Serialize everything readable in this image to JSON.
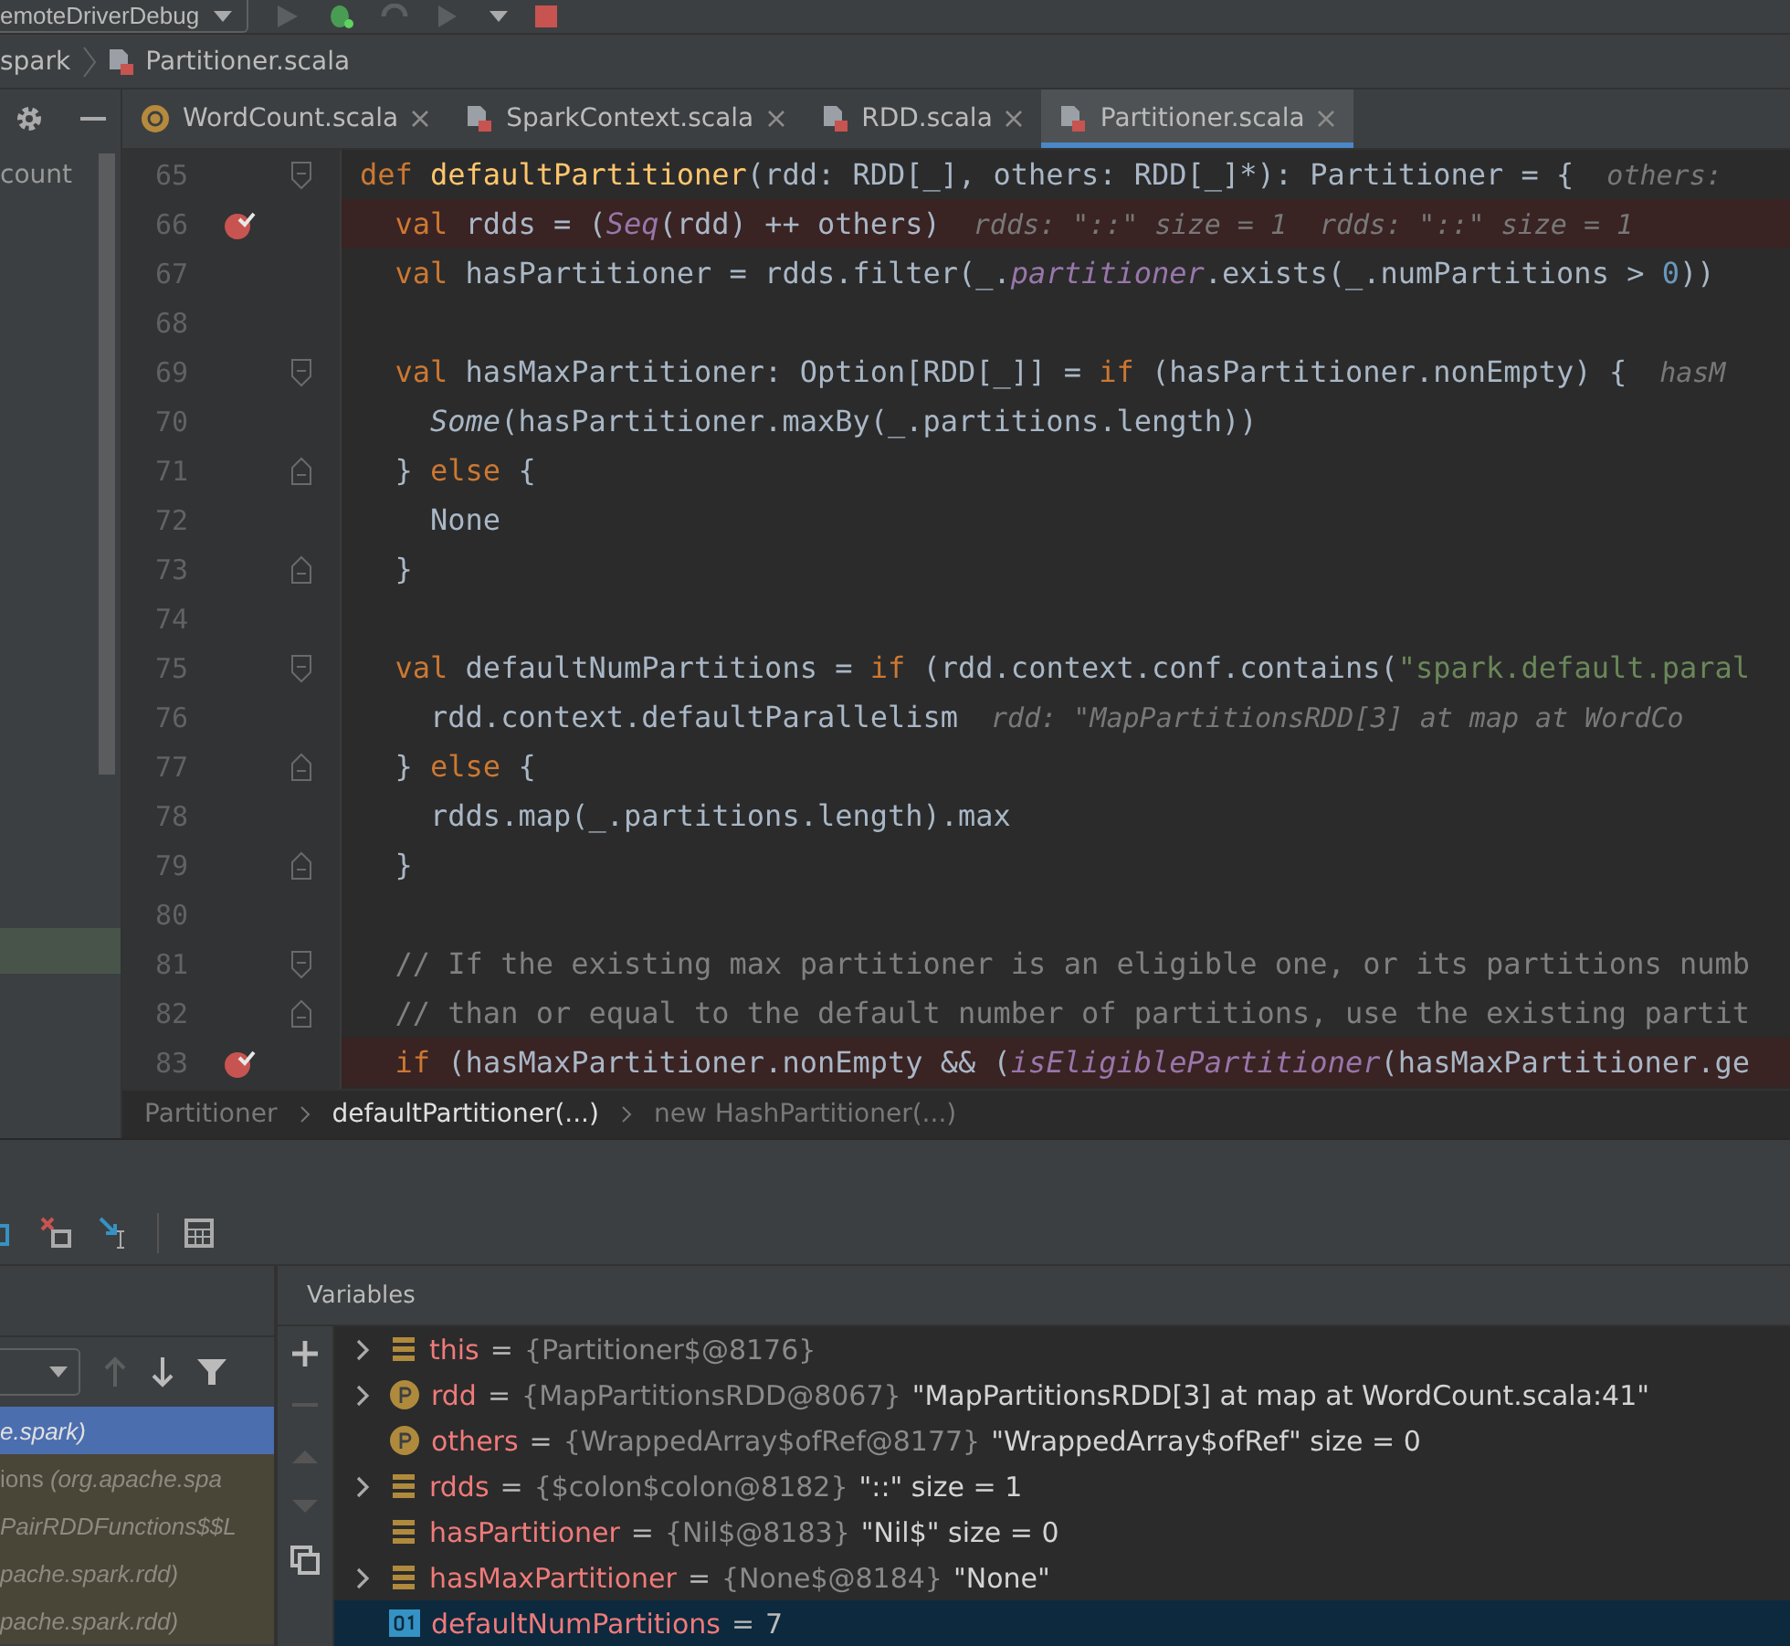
{
  "toolbar": {
    "run_config": "emoteDriverDebug"
  },
  "navigation": {
    "crumbs": [
      {
        "label": "spark",
        "kind": "folder"
      },
      {
        "label": "Partitioner.scala",
        "kind": "file"
      }
    ]
  },
  "project_panel": {
    "label": "count",
    "highlighted_row": true
  },
  "tabs": [
    {
      "label": "WordCount.scala",
      "kind": "source",
      "selected": false
    },
    {
      "label": "SparkContext.scala",
      "kind": "library",
      "selected": false
    },
    {
      "label": "RDD.scala",
      "kind": "library",
      "selected": false
    },
    {
      "label": "Partitioner.scala",
      "kind": "library",
      "selected": true
    }
  ],
  "code_lines": [
    {
      "number": "65",
      "kind": "fold_start",
      "breakpoint": false,
      "tokens": [
        {
          "kind": "keyword",
          "text": "def "
        },
        {
          "kind": "function",
          "text": "defaultPartitioner"
        },
        {
          "kind": "plain",
          "text": "(rdd: RDD[_], others: RDD[_]*): Partitioner = {"
        },
        {
          "kind": "hint",
          "text": "others:"
        }
      ]
    },
    {
      "number": "66",
      "kind": "plain",
      "breakpoint": true,
      "tokens": [
        {
          "kind": "keyword",
          "text": "  val "
        },
        {
          "kind": "plain",
          "text": "rdds = ("
        },
        {
          "kind": "member",
          "text": "Seq"
        },
        {
          "kind": "plain",
          "text": "(rdd) ++ others)"
        },
        {
          "kind": "hint",
          "text": "rdds: \"::\" size = 1"
        },
        {
          "kind": "hint",
          "text": "rdds: \"::\" size = 1"
        }
      ]
    },
    {
      "number": "67",
      "kind": "plain",
      "breakpoint": false,
      "tokens": [
        {
          "kind": "keyword",
          "text": "  val "
        },
        {
          "kind": "plain",
          "text": "hasPartitioner = rdds.filter(_."
        },
        {
          "kind": "member",
          "text": "partitioner"
        },
        {
          "kind": "plain",
          "text": ".exists(_.numPartitions > "
        },
        {
          "kind": "number",
          "text": "0"
        },
        {
          "kind": "plain",
          "text": "))"
        }
      ]
    },
    {
      "number": "68",
      "kind": "plain",
      "breakpoint": false
    },
    {
      "number": "69",
      "kind": "fold_start",
      "breakpoint": false,
      "tokens": [
        {
          "kind": "keyword",
          "text": "  val "
        },
        {
          "kind": "plain",
          "text": "hasMaxPartitioner: Option[RDD[_]] = "
        },
        {
          "kind": "keyword",
          "text": "if "
        },
        {
          "kind": "plain",
          "text": "(hasPartitioner.nonEmpty) {"
        },
        {
          "kind": "hint",
          "text": "hasM"
        }
      ]
    },
    {
      "number": "70",
      "kind": "plain",
      "breakpoint": false,
      "tokens": [
        {
          "kind": "italic",
          "text": "    Some"
        },
        {
          "kind": "plain",
          "text": "(hasPartitioner.maxBy(_.partitions.length))"
        }
      ]
    },
    {
      "number": "71",
      "kind": "fold_end",
      "breakpoint": false,
      "tokens": [
        {
          "kind": "plain",
          "text": "  } "
        },
        {
          "kind": "keyword",
          "text": "else "
        },
        {
          "kind": "plain",
          "text": "{"
        }
      ]
    },
    {
      "number": "72",
      "kind": "plain",
      "breakpoint": false,
      "tokens": [
        {
          "kind": "plain",
          "text": "    None"
        }
      ]
    },
    {
      "number": "73",
      "kind": "fold_end",
      "breakpoint": false,
      "tokens": [
        {
          "kind": "plain",
          "text": "  }"
        }
      ]
    },
    {
      "number": "74",
      "kind": "plain",
      "breakpoint": false
    },
    {
      "number": "75",
      "kind": "fold_start",
      "breakpoint": false,
      "tokens": [
        {
          "kind": "keyword",
          "text": "  val "
        },
        {
          "kind": "plain",
          "text": "defaultNumPartitions = "
        },
        {
          "kind": "keyword",
          "text": "if "
        },
        {
          "kind": "plain",
          "text": "(rdd.context.conf.contains("
        },
        {
          "kind": "string",
          "text": "\"spark.default.paral"
        }
      ]
    },
    {
      "number": "76",
      "kind": "plain",
      "breakpoint": false,
      "tokens": [
        {
          "kind": "plain",
          "text": "    rdd.context.defaultParallelism"
        },
        {
          "kind": "hint",
          "text": "rdd: \"MapPartitionsRDD[3] at map at WordCo"
        }
      ]
    },
    {
      "number": "77",
      "kind": "fold_end",
      "breakpoint": false,
      "tokens": [
        {
          "kind": "plain",
          "text": "  } "
        },
        {
          "kind": "keyword",
          "text": "else "
        },
        {
          "kind": "plain",
          "text": "{"
        }
      ]
    },
    {
      "number": "78",
      "kind": "plain",
      "breakpoint": false,
      "tokens": [
        {
          "kind": "plain",
          "text": "    rdds.map(_.partitions.length).max"
        }
      ]
    },
    {
      "number": "79",
      "kind": "fold_end",
      "breakpoint": false,
      "tokens": [
        {
          "kind": "plain",
          "text": "  }"
        }
      ]
    },
    {
      "number": "80",
      "kind": "plain",
      "breakpoint": false
    },
    {
      "number": "81",
      "kind": "fold_start",
      "breakpoint": false,
      "tokens": [
        {
          "kind": "comment",
          "text": "  // If the existing max partitioner is an eligible one, or its partitions numb"
        }
      ]
    },
    {
      "number": "82",
      "kind": "fold_end",
      "breakpoint": false,
      "tokens": [
        {
          "kind": "comment",
          "text": "  // than or equal to the default number of partitions, use the existing partit"
        }
      ]
    },
    {
      "number": "83",
      "kind": "plain",
      "breakpoint": true,
      "tokens": [
        {
          "kind": "keyword",
          "text": "  if "
        },
        {
          "kind": "plain",
          "text": "(hasMaxPartitioner.nonEmpty && ("
        },
        {
          "kind": "member",
          "text": "isEligiblePartitioner"
        },
        {
          "kind": "plain",
          "text": "(hasMaxPartitioner.ge"
        }
      ]
    }
  ],
  "editor_breadcrumbs": [
    {
      "label": "Partitioner",
      "selected": false
    },
    {
      "label": "defaultPartitioner(...)",
      "selected": true
    },
    {
      "label": "new HashPartitioner(...)",
      "selected": false
    }
  ],
  "frames": {
    "rows": [
      {
        "text": "*e.spark)*",
        "selected": true
      },
      {
        "text": "ions *(org.apache.spa*",
        "selected": false
      },
      {
        "text": "*PairRDDFunctions$$L*",
        "selected": false
      },
      {
        "text": "*pache.spark.rdd)*",
        "selected": false
      },
      {
        "text": "*pache.spark.rdd)*",
        "selected": false
      }
    ]
  },
  "variables": {
    "title": "Variables",
    "rows": [
      {
        "kind": "field",
        "expandable": true,
        "name": "this",
        "separator": "=",
        "ref": "{Partitioner$@8176}",
        "selected": false
      },
      {
        "kind": "parameter",
        "expandable": true,
        "name": "rdd",
        "separator": "=",
        "ref": "{MapPartitionsRDD@8067}",
        "value": "\"MapPartitionsRDD[3] at map at WordCount.scala:41\"",
        "selected": false
      },
      {
        "kind": "parameter",
        "expandable": false,
        "name": "others",
        "separator": "=",
        "ref": "{WrappedArray$ofRef@8177}",
        "value": "\"WrappedArray$ofRef\" size = 0",
        "selected": false
      },
      {
        "kind": "field",
        "expandable": true,
        "name": "rdds",
        "separator": "=",
        "ref": "{$colon$colon@8182}",
        "value": "\"::\" size = 1",
        "selected": false
      },
      {
        "kind": "field",
        "expandable": false,
        "name": "hasPartitioner",
        "separator": "=",
        "ref": "{Nil$@8183}",
        "value": "\"Nil$\" size = 0",
        "selected": false
      },
      {
        "kind": "field",
        "expandable": true,
        "name": "hasMaxPartitioner",
        "separator": "=",
        "ref": "{None$@8184}",
        "value": "\"None\"",
        "selected": false
      },
      {
        "kind": "primitive",
        "expandable": false,
        "name": "defaultNumPartitions",
        "separator": "=",
        "ref": "7",
        "selected": true
      }
    ]
  }
}
